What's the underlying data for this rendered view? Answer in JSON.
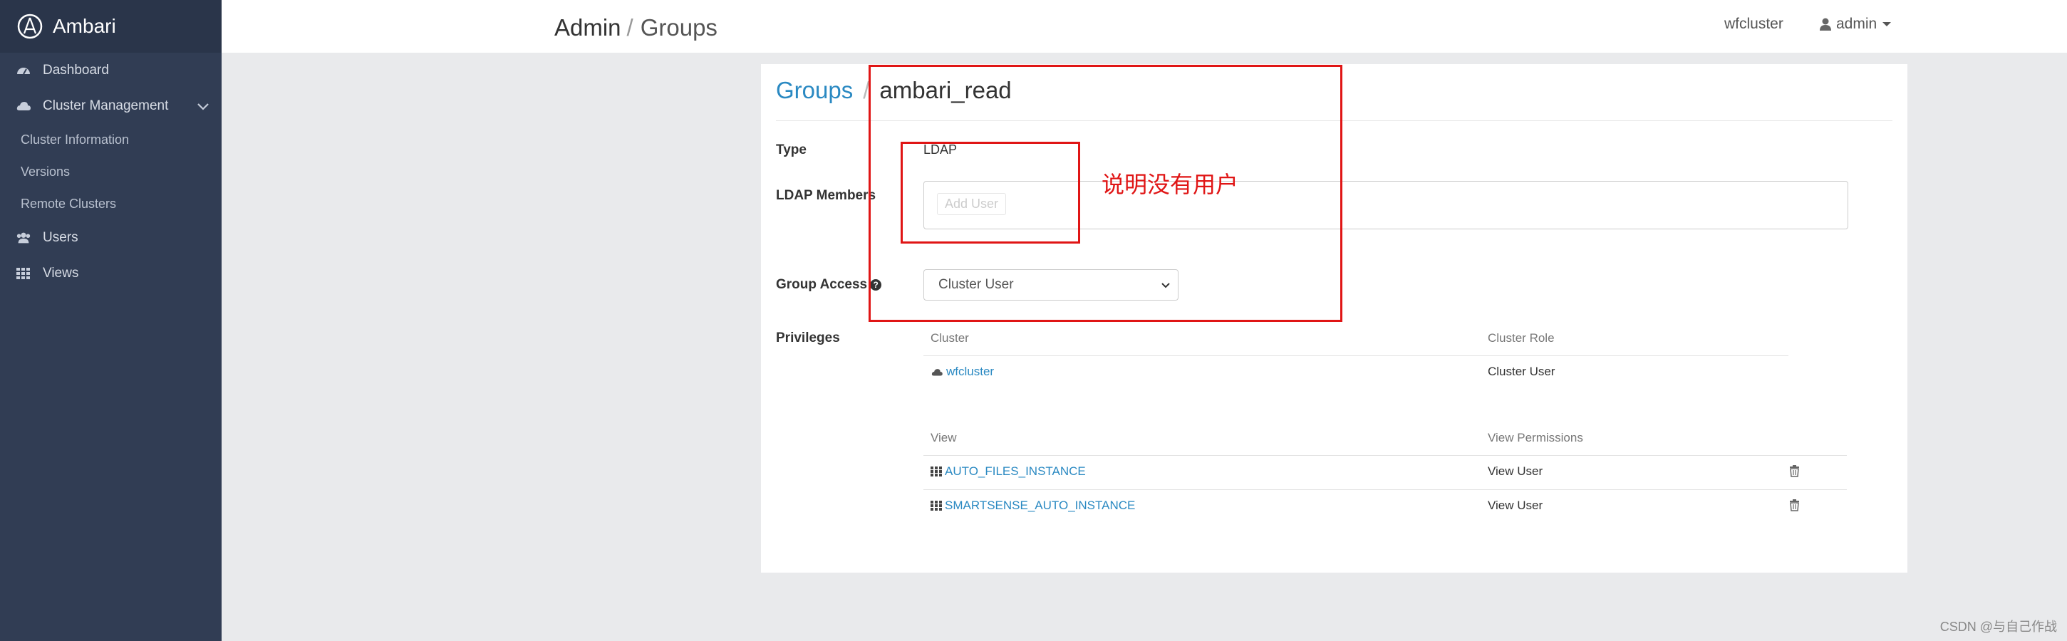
{
  "brand": {
    "name": "Ambari"
  },
  "sidebar": {
    "items": [
      {
        "label": "Dashboard",
        "icon": "dashboard-icon"
      },
      {
        "label": "Cluster Management",
        "icon": "cloud-icon"
      },
      {
        "label": "Users",
        "icon": "users-icon"
      },
      {
        "label": "Views",
        "icon": "grid-icon"
      }
    ],
    "sub_items": [
      {
        "label": "Cluster Information"
      },
      {
        "label": "Versions"
      },
      {
        "label": "Remote Clusters"
      }
    ]
  },
  "header": {
    "title": "Admin",
    "separator": "/",
    "subtitle": "Groups",
    "cluster": "wfcluster",
    "user": "admin"
  },
  "breadcrumb": {
    "parent": "Groups",
    "separator": "/",
    "current": "ambari_read"
  },
  "fields": {
    "type_label": "Type",
    "type_value": "LDAP",
    "members_label": "LDAP Members",
    "add_user_placeholder": "Add User",
    "group_access_label": "Group Access",
    "group_access_value": "Cluster User",
    "privileges_label": "Privileges"
  },
  "cluster_table": {
    "headers": [
      "Cluster",
      "Cluster Role"
    ],
    "rows": [
      {
        "name": "wfcluster",
        "role": "Cluster User"
      }
    ]
  },
  "view_table": {
    "headers": [
      "View",
      "View Permissions"
    ],
    "rows": [
      {
        "name": "AUTO_FILES_INSTANCE",
        "permission": "View User"
      },
      {
        "name": "SMARTSENSE_AUTO_INSTANCE",
        "permission": "View User"
      }
    ]
  },
  "annotation": {
    "text": "说明没有用户",
    "color": "#e01515"
  },
  "watermark": "CSDN @与自己作战",
  "colors": {
    "sidebar": "#313d54",
    "link": "#2a89c2"
  }
}
